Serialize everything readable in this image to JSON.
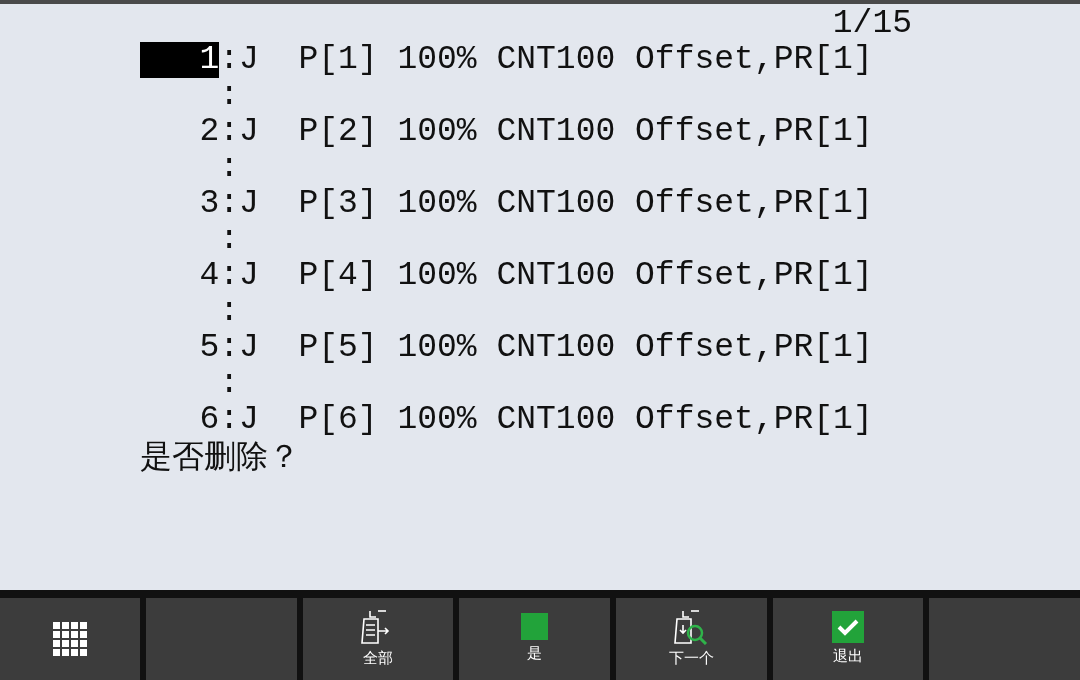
{
  "page_indicator": "1/15",
  "lines": [
    {
      "number": "1",
      "selected": true,
      "instruction": ":J  P[1] 100% CNT100 Offset,PR[1]",
      "continuation": ":"
    },
    {
      "number": "2",
      "selected": false,
      "instruction": ":J  P[2] 100% CNT100 Offset,PR[1]",
      "continuation": ":"
    },
    {
      "number": "3",
      "selected": false,
      "instruction": ":J  P[3] 100% CNT100 Offset,PR[1]",
      "continuation": ":"
    },
    {
      "number": "4",
      "selected": false,
      "instruction": ":J  P[4] 100% CNT100 Offset,PR[1]",
      "continuation": ":"
    },
    {
      "number": "5",
      "selected": false,
      "instruction": ":J  P[5] 100% CNT100 Offset,PR[1]",
      "continuation": ":"
    },
    {
      "number": "6",
      "selected": false,
      "instruction": ":J  P[6] 100% CNT100 Offset,PR[1]"
    }
  ],
  "prompt": "是否删除？",
  "function_keys": [
    {
      "kind": "menu"
    },
    {
      "kind": "empty"
    },
    {
      "kind": "all",
      "label": "全部"
    },
    {
      "kind": "yes",
      "label": "是"
    },
    {
      "kind": "next",
      "label": "下一个"
    },
    {
      "kind": "exit",
      "label": "退出"
    },
    {
      "kind": "empty"
    }
  ]
}
